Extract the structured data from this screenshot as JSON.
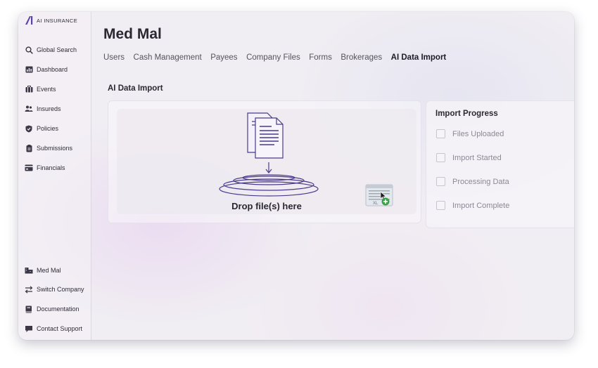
{
  "brand": {
    "logo_text": "AI INSURANCE"
  },
  "sidebar": {
    "top_items": [
      {
        "label": "Global Search",
        "icon": "search-icon"
      },
      {
        "label": "Dashboard",
        "icon": "dashboard-icon"
      },
      {
        "label": "Events",
        "icon": "events-icon"
      },
      {
        "label": "Insureds",
        "icon": "insureds-icon"
      },
      {
        "label": "Policies",
        "icon": "shield-icon"
      },
      {
        "label": "Submissions",
        "icon": "submissions-icon"
      },
      {
        "label": "Financials",
        "icon": "financials-icon"
      }
    ],
    "bottom_items": [
      {
        "label": "Med Mal",
        "icon": "company-icon"
      },
      {
        "label": "Switch Company",
        "icon": "switch-icon"
      },
      {
        "label": "Documentation",
        "icon": "book-icon"
      },
      {
        "label": "Contact Support",
        "icon": "chat-icon"
      }
    ]
  },
  "page": {
    "title": "Med Mal"
  },
  "tabs": [
    {
      "label": "Users"
    },
    {
      "label": "Cash Management"
    },
    {
      "label": "Payees"
    },
    {
      "label": "Company Files"
    },
    {
      "label": "Forms"
    },
    {
      "label": "Brokerages"
    },
    {
      "label": "AI Data Import",
      "active": true
    }
  ],
  "import": {
    "section_title": "AI Data Import",
    "drop_text": "Drop file(s) here"
  },
  "progress": {
    "title": "Import Progress",
    "steps": [
      {
        "label": "Files Uploaded",
        "checked": false
      },
      {
        "label": "Import Started",
        "checked": false
      },
      {
        "label": "Processing Data",
        "checked": false
      },
      {
        "label": "Import Complete",
        "checked": false
      }
    ]
  },
  "colors": {
    "accent": "#5a43a8",
    "text": "#2b2833",
    "muted": "#8d8896"
  }
}
